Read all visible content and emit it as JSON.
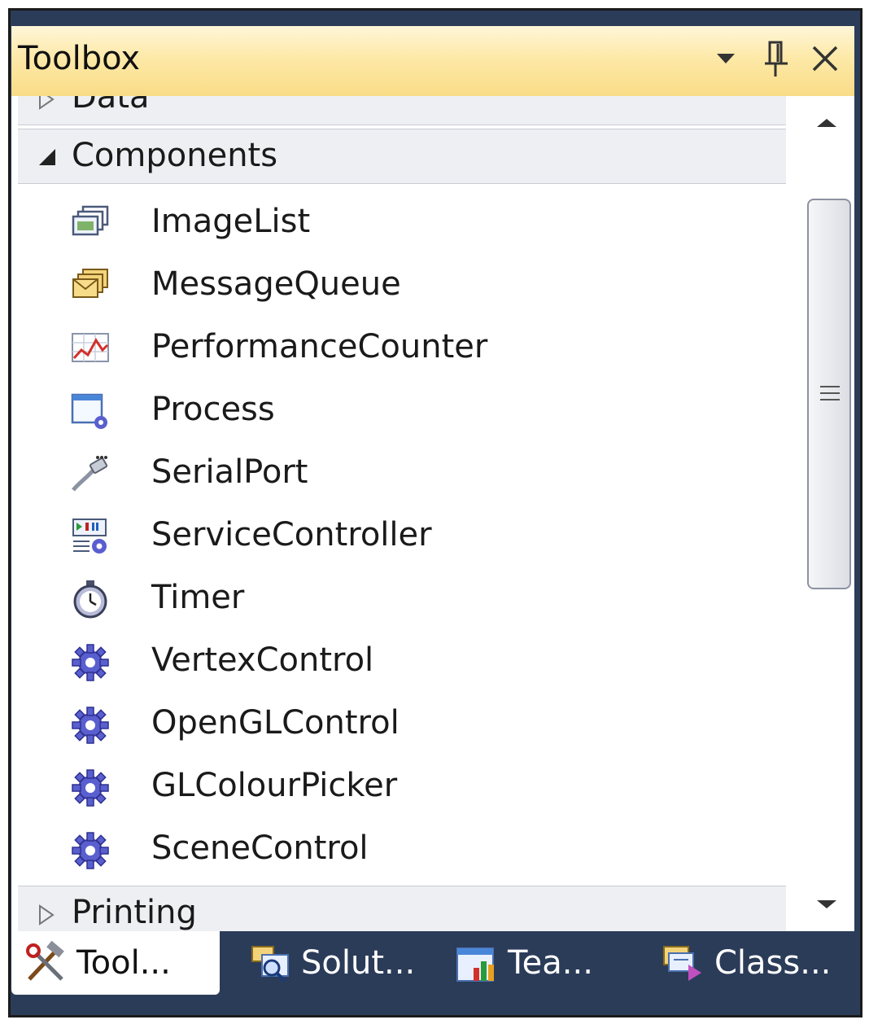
{
  "panel": {
    "title": "Toolbox",
    "buttons": {
      "dropdown": "window-position-menu",
      "pin": "auto-hide-pin",
      "close": "close"
    }
  },
  "groups": {
    "data": {
      "label": "Data",
      "expanded": false
    },
    "components": {
      "label": "Components",
      "expanded": true
    },
    "printing": {
      "label": "Printing",
      "expanded": false
    }
  },
  "components": {
    "items": [
      {
        "label": "ImageList",
        "icon": "imagelist-icon"
      },
      {
        "label": "MessageQueue",
        "icon": "messagequeue-icon"
      },
      {
        "label": "PerformanceCounter",
        "icon": "performancecounter-icon"
      },
      {
        "label": "Process",
        "icon": "process-icon"
      },
      {
        "label": "SerialPort",
        "icon": "serialport-icon"
      },
      {
        "label": "ServiceController",
        "icon": "servicecontroller-icon"
      },
      {
        "label": "Timer",
        "icon": "timer-icon"
      },
      {
        "label": "VertexControl",
        "icon": "gear-icon"
      },
      {
        "label": "OpenGLControl",
        "icon": "gear-icon"
      },
      {
        "label": "GLColourPicker",
        "icon": "gear-icon"
      },
      {
        "label": "SceneControl",
        "icon": "gear-icon"
      }
    ]
  },
  "tabs": [
    {
      "label": "Tool...",
      "icon": "toolbox-icon",
      "active": true
    },
    {
      "label": "Solut...",
      "icon": "solution-explorer-icon",
      "active": false
    },
    {
      "label": "Tea...",
      "icon": "team-explorer-icon",
      "active": false
    },
    {
      "label": "Class...",
      "icon": "class-view-icon",
      "active": false
    }
  ],
  "colors": {
    "title_bar": "#f9dc86",
    "tab_strip": "#2b3c59",
    "group_header": "#eeeff3",
    "gear": "#5a5fcf"
  }
}
